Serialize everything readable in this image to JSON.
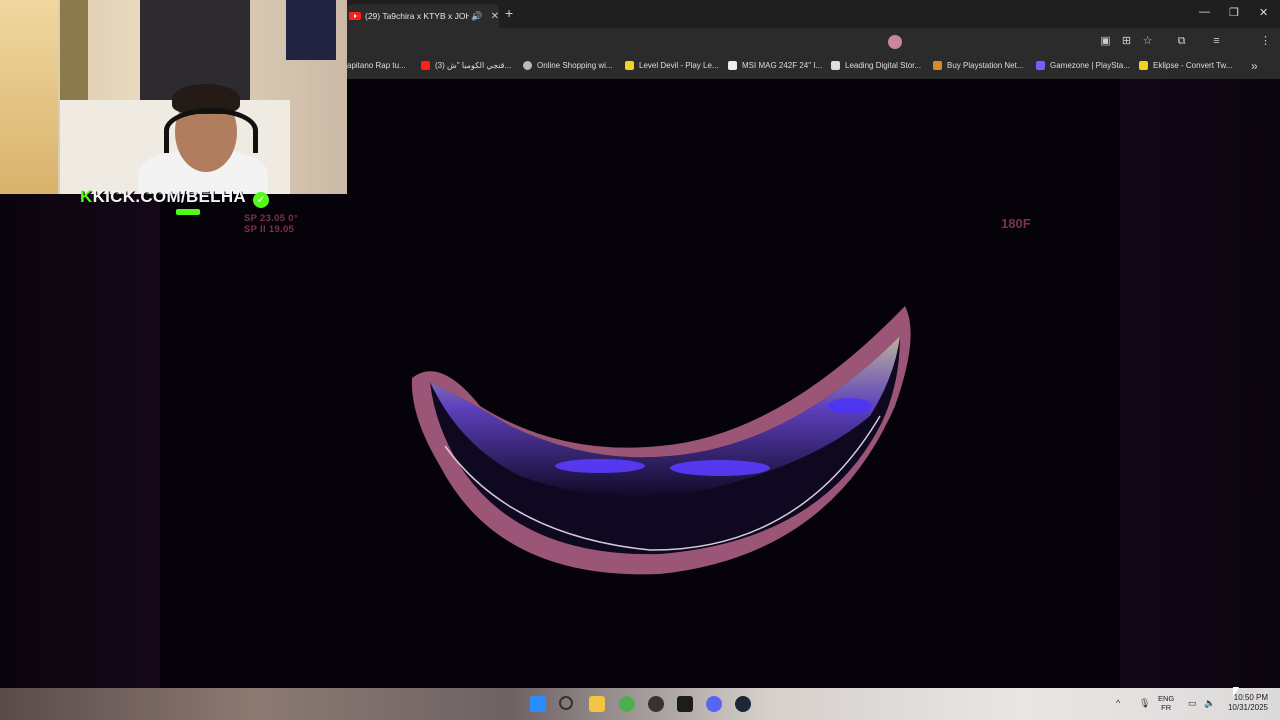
{
  "browser": {
    "tab": {
      "title": "(29) Ta9chira x KTYB x JOH...",
      "audio_icon": "speaker-icon",
      "close": "✕"
    },
    "new_tab": "+",
    "window_controls": {
      "minimize": "—",
      "restore": "❐",
      "close": "✕"
    },
    "bookmarks": [
      {
        "label": "apitano Rap tu...",
        "color": "#2b2b2b"
      },
      {
        "label": "(3) قنجي الكومبا \"ش...",
        "color": "#ff1e1e"
      },
      {
        "label": "Online Shopping wi...",
        "color": "#bbbbbb"
      },
      {
        "label": "Level Devil - Play Le...",
        "color": "#f4d21d"
      },
      {
        "label": "MSI MAG 242F 24\" I...",
        "color": "#eeeeee"
      },
      {
        "label": "Leading Digital Stor...",
        "color": "#dddddd"
      },
      {
        "label": "Buy Playstation Net...",
        "color": "#d98a2b"
      },
      {
        "label": "Gamezone | PlaySta...",
        "color": "#7a5cff"
      },
      {
        "label": "Eklipse - Convert Tw...",
        "color": "#f4d21d"
      }
    ],
    "bookmarks_more": "»"
  },
  "stream": {
    "kick_prefix": "K",
    "kick_text": "KICK.COM/BELHA",
    "verified": "✓"
  },
  "video": {
    "hud_line1": "SP 23.05 0°",
    "hud_line2": "SP II 19.05",
    "hud_frame": "180F"
  },
  "taskbar": {
    "lang_top": "ENG",
    "lang_bottom": "FR",
    "time": "10:50 PM",
    "date": "10/31/2025",
    "tray_chevron": "^"
  }
}
